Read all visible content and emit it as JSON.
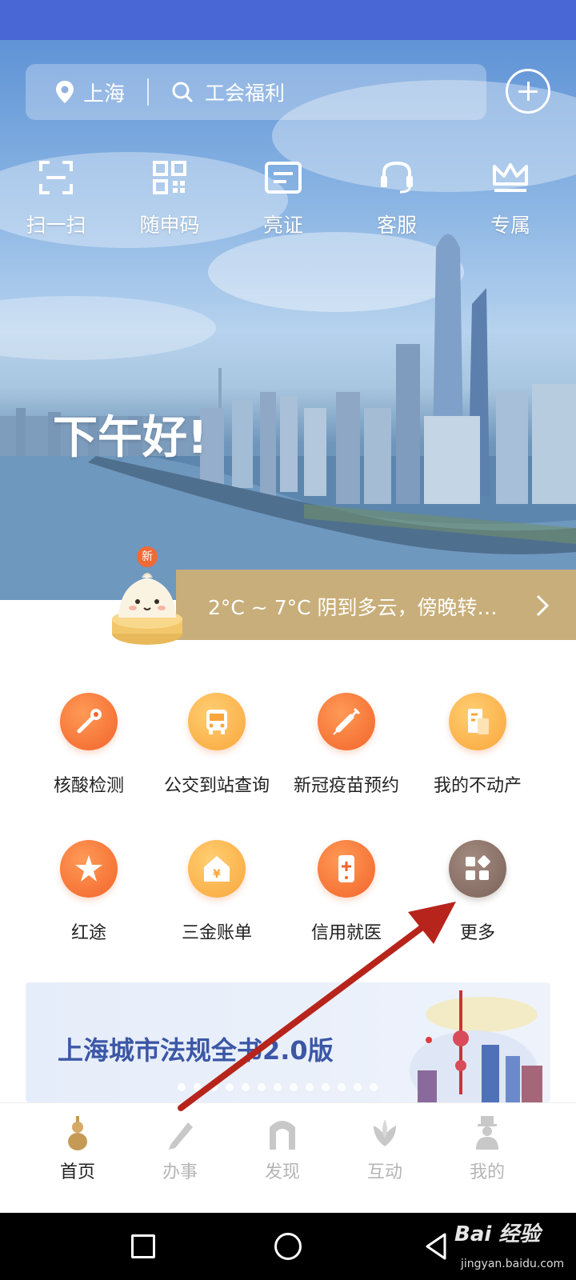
{
  "header": {
    "location": "上海",
    "search_placeholder": "工会福利"
  },
  "quick_actions": [
    {
      "label": "扫一扫",
      "icon": "scan-icon"
    },
    {
      "label": "随申码",
      "icon": "qr-code-icon"
    },
    {
      "label": "亮证",
      "icon": "id-card-icon"
    },
    {
      "label": "客服",
      "icon": "headset-icon"
    },
    {
      "label": "专属",
      "icon": "crown-icon"
    }
  ],
  "greeting": "下午好!",
  "weather": {
    "badge": "新",
    "text": "2°C ~ 7°C  阴到多云，傍晚转…"
  },
  "services": [
    {
      "label": "核酸检测",
      "icon": "swab-test-icon"
    },
    {
      "label": "公交到站查询",
      "icon": "bus-icon"
    },
    {
      "label": "新冠疫苗预约",
      "icon": "syringe-icon"
    },
    {
      "label": "我的不动产",
      "icon": "property-doc-icon"
    },
    {
      "label": "红途",
      "icon": "red-star-icon"
    },
    {
      "label": "三金账单",
      "icon": "house-yuan-icon"
    },
    {
      "label": "信用就医",
      "icon": "medical-phone-icon"
    },
    {
      "label": "更多",
      "icon": "more-grid-icon"
    }
  ],
  "banner": {
    "title": "上海城市法规全书2.0版"
  },
  "tabs": [
    {
      "label": "首页",
      "icon": "gourd-home-icon",
      "active": true
    },
    {
      "label": "办事",
      "icon": "pen-icon",
      "active": false
    },
    {
      "label": "发现",
      "icon": "arch-icon",
      "active": false
    },
    {
      "label": "互动",
      "icon": "magnolia-icon",
      "active": false
    },
    {
      "label": "我的",
      "icon": "person-hat-icon",
      "active": false
    }
  ],
  "watermark": {
    "logo": "Bai 经验",
    "sub": "jingyan.baidu.com"
  },
  "colors": {
    "status_bar": "#4a67d6",
    "weather_bar": "#c8ae7a",
    "accent_orange": "#f2642b",
    "banner_title": "#3b57a6",
    "annotation_arrow": "#b7241c"
  }
}
